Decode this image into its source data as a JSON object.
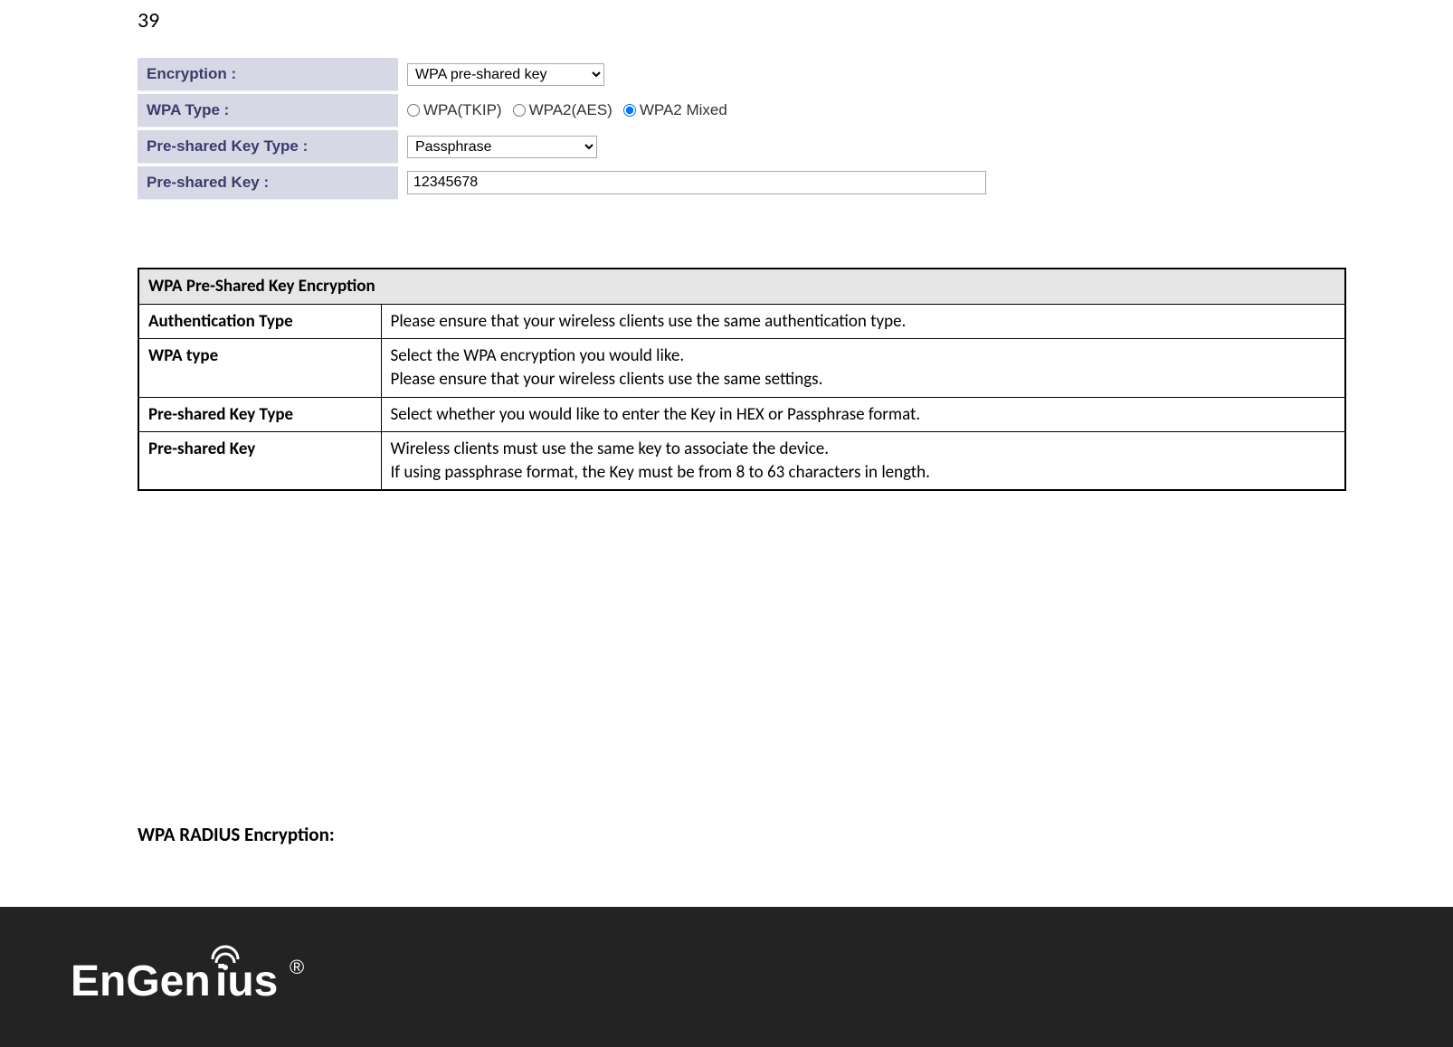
{
  "page_number": "39",
  "form": {
    "encryption": {
      "label": "Encryption :",
      "selected": "WPA pre-shared key"
    },
    "wpa_type": {
      "label": "WPA Type :",
      "options": {
        "tkip": "WPA(TKIP)",
        "aes": "WPA2(AES)",
        "mixed": "WPA2 Mixed"
      },
      "selected": "mixed"
    },
    "psk_type": {
      "label": "Pre-shared Key Type :",
      "selected": "Passphrase"
    },
    "psk": {
      "label": "Pre-shared Key :",
      "value": "12345678"
    }
  },
  "desc_table": {
    "header": "WPA Pre-Shared Key Encryption",
    "rows": [
      {
        "name": "Authentication Type",
        "text": "Please ensure that your wireless clients use the same authentication type."
      },
      {
        "name": "WPA type",
        "text": "Select the WPA encryption you would like.\nPlease ensure that your wireless clients use the same settings."
      },
      {
        "name": "Pre-shared Key Type",
        "text": "Select whether you would like to enter the Key in HEX or Passphrase format."
      },
      {
        "name": "Pre-shared Key",
        "text": "Wireless clients must use the same key to associate the device.\nIf using passphrase format, the Key must be from 8 to 63 characters in length."
      }
    ]
  },
  "next_section_heading": "WPA RADIUS Encryption:",
  "brand": "EnGenius"
}
